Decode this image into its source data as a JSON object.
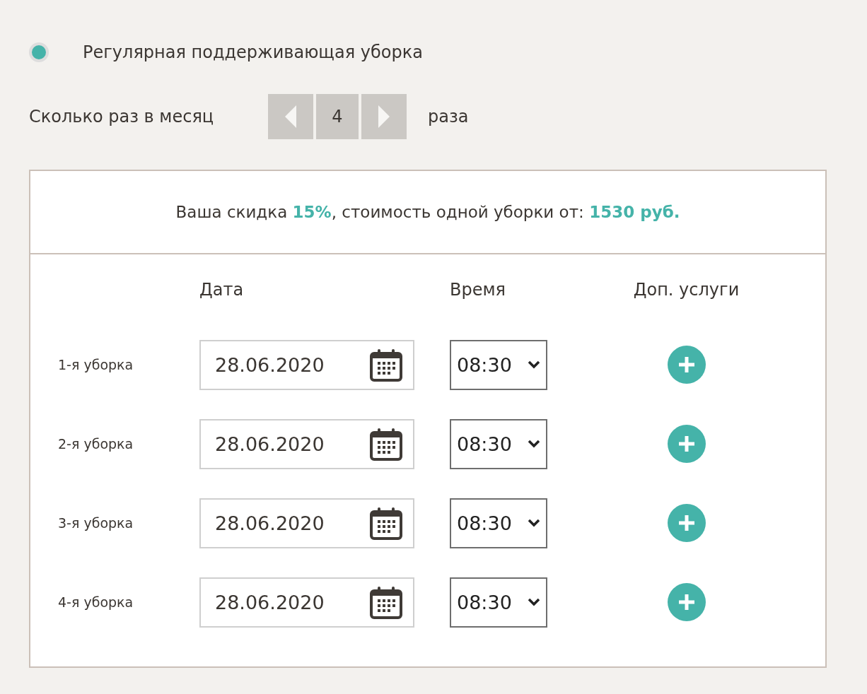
{
  "cleaning_type": {
    "label": "Регулярная поддерживающая уборка",
    "selected": true
  },
  "frequency": {
    "label": "Сколько раз в месяц",
    "value": "4",
    "unit": "раза"
  },
  "discount_text": "Ваша скидка **15%**, стоимость одной уборки от: **1530 руб.**",
  "table": {
    "columns": [
      "Дата",
      "Время",
      "Доп. услуги"
    ],
    "rows": [
      {
        "label": "1-я уборка",
        "date": "28.06.2020",
        "time": "08:30"
      },
      {
        "label": "2-я уборка",
        "date": "28.06.2020",
        "time": "08:30"
      },
      {
        "label": "3-я уборка",
        "date": "28.06.2020",
        "time": "08:30"
      },
      {
        "label": "4-я уборка",
        "date": "28.06.2020",
        "time": "08:30"
      }
    ]
  }
}
